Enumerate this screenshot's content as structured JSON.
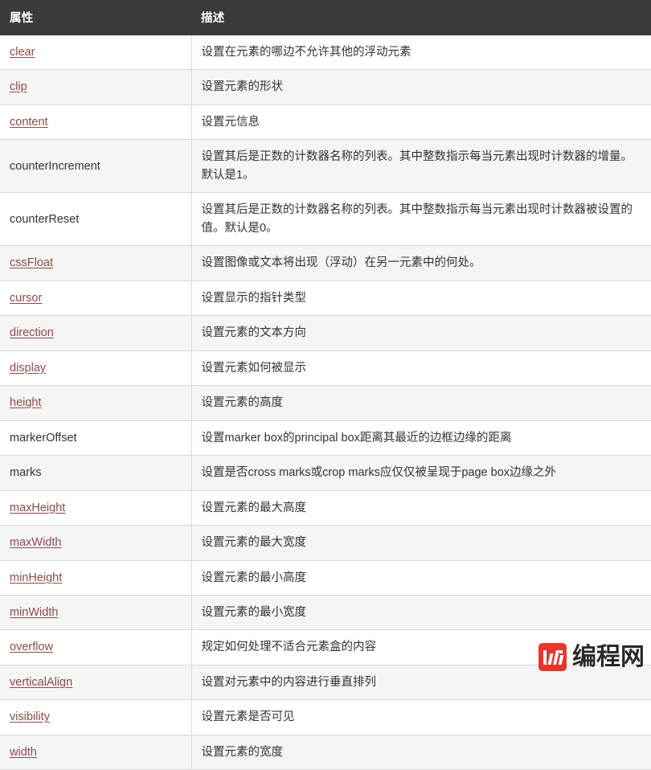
{
  "table": {
    "columns": [
      {
        "key": "property",
        "label": "属性"
      },
      {
        "key": "description",
        "label": "描述"
      }
    ],
    "rows": [
      {
        "property": "clear",
        "is_link": true,
        "description": "设置在元素的哪边不允许其他的浮动元素"
      },
      {
        "property": "clip",
        "is_link": true,
        "description": "设置元素的形状"
      },
      {
        "property": "content",
        "is_link": true,
        "description": "设置元信息"
      },
      {
        "property": "counterIncrement",
        "is_link": false,
        "description": "设置其后是正数的计数器名称的列表。其中整数指示每当元素出现时计数器的增量。默认是1。"
      },
      {
        "property": "counterReset",
        "is_link": false,
        "description": "设置其后是正数的计数器名称的列表。其中整数指示每当元素出现时计数器被设置的值。默认是0。"
      },
      {
        "property": "cssFloat",
        "is_link": true,
        "description": "设置图像或文本将出现（浮动）在另一元素中的何处。"
      },
      {
        "property": "cursor",
        "is_link": true,
        "description": "设置显示的指针类型"
      },
      {
        "property": "direction",
        "is_link": true,
        "description": "设置元素的文本方向"
      },
      {
        "property": "display",
        "is_link": true,
        "description": "设置元素如何被显示"
      },
      {
        "property": "height",
        "is_link": true,
        "description": "设置元素的高度"
      },
      {
        "property": "markerOffset",
        "is_link": false,
        "description": "设置marker box的principal box距离其最近的边框边缘的距离"
      },
      {
        "property": "marks",
        "is_link": false,
        "description": "设置是否cross marks或crop marks应仅仅被呈现于page box边缘之外"
      },
      {
        "property": "maxHeight",
        "is_link": true,
        "description": "设置元素的最大高度"
      },
      {
        "property": "maxWidth",
        "is_link": true,
        "description": "设置元素的最大宽度"
      },
      {
        "property": "minHeight",
        "is_link": true,
        "description": "设置元素的最小高度"
      },
      {
        "property": "minWidth",
        "is_link": true,
        "description": "设置元素的最小宽度"
      },
      {
        "property": "overflow",
        "is_link": true,
        "description": "规定如何处理不适合元素盒的内容"
      },
      {
        "property": "verticalAlign",
        "is_link": true,
        "description": "设置对元素中的内容进行垂直排列"
      },
      {
        "property": "visibility",
        "is_link": true,
        "description": "设置元素是否可见"
      },
      {
        "property": "width",
        "is_link": true,
        "description": "设置元素的宽度"
      }
    ]
  },
  "watermark": {
    "text": "编程网",
    "logo_color": "#e8261c"
  },
  "theme": {
    "header_bg": "#3b3b3b",
    "header_text": "#ffffff",
    "link_color": "#8c4a4a",
    "body_text": "#333333",
    "row_alt_bg": "#f5f5f5",
    "border_color": "#d8d8d8"
  }
}
